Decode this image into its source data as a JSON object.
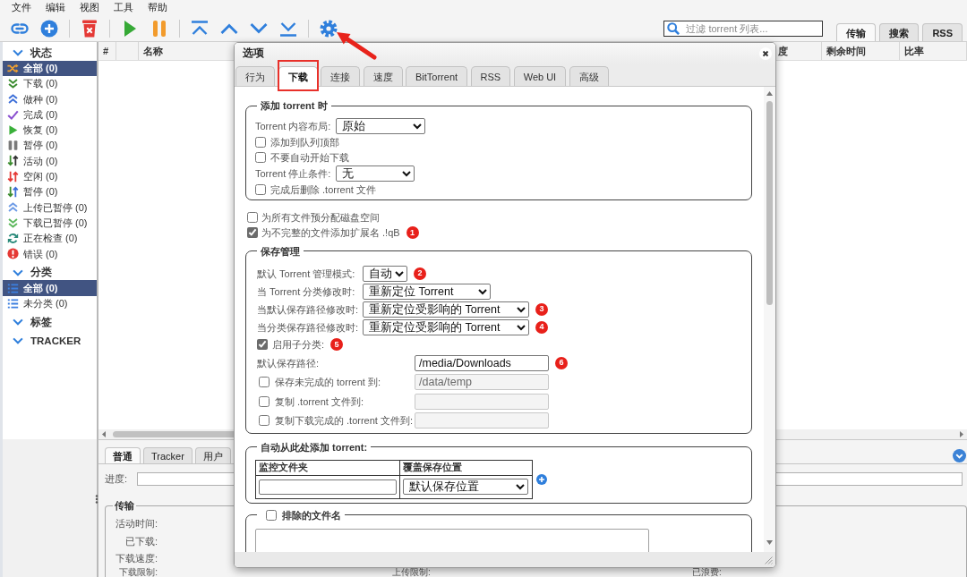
{
  "menu": [
    "文件",
    "编辑",
    "视图",
    "工具",
    "帮助"
  ],
  "search": {
    "placeholder": "过滤 torrent 列表..."
  },
  "view_tabs": [
    {
      "label": "传输",
      "selected": true
    },
    {
      "label": "搜索",
      "selected": false
    },
    {
      "label": "RSS",
      "selected": false
    }
  ],
  "sidebar": [
    {
      "title": "状态",
      "expanded": true,
      "items": [
        {
          "label": "全部 (0)",
          "selected": true
        },
        {
          "label": "下载 (0)",
          "selected": false
        },
        {
          "label": "做种 (0)",
          "selected": false
        },
        {
          "label": "完成 (0)",
          "selected": false
        },
        {
          "label": "恢复 (0)",
          "selected": false
        },
        {
          "label": "暂停 (0)",
          "selected": false
        },
        {
          "label": "活动 (0)",
          "selected": false
        },
        {
          "label": "空闲 (0)",
          "selected": false
        },
        {
          "label": "暂停 (0)",
          "selected": false
        },
        {
          "label": "上传已暂停 (0)",
          "selected": false
        },
        {
          "label": "下载已暂停 (0)",
          "selected": false
        },
        {
          "label": "正在检查 (0)",
          "selected": false
        },
        {
          "label": "错误 (0)",
          "selected": false
        }
      ]
    },
    {
      "title": "分类",
      "expanded": true,
      "items": [
        {
          "label": "全部 (0)",
          "selected": true
        },
        {
          "label": "未分类 (0)",
          "selected": false
        }
      ]
    },
    {
      "title": "标签",
      "expanded": true
    },
    {
      "title": "TRACKER",
      "expanded": true
    }
  ],
  "torrent_list": {
    "columns": [
      "#",
      "名称",
      "度",
      "剩余时间",
      "比率"
    ]
  },
  "details_panel": {
    "tabs": [
      {
        "label": "普通",
        "selected": true
      },
      {
        "label": "Tracker",
        "selected": false
      },
      {
        "label": "用户",
        "selected": false
      }
    ],
    "progress": {
      "label": "进度:",
      "level": 0
    },
    "transfer": {
      "title": "传输",
      "rows": [
        [
          "活动时间:"
        ],
        [
          "已下载:"
        ],
        [
          "下载速度:"
        ],
        [
          "下载限制:",
          "上传限制:",
          "已浪费:"
        ]
      ]
    }
  },
  "options_dialog": {
    "title": "选项",
    "tabs": [
      {
        "label": "行为",
        "selected": false,
        "highlighted": false
      },
      {
        "label": "下载",
        "selected": true,
        "highlighted": true
      },
      {
        "label": "连接",
        "selected": false,
        "highlighted": false
      },
      {
        "label": "速度",
        "selected": false,
        "highlighted": false
      },
      {
        "label": "BitTorrent",
        "selected": false,
        "highlighted": false
      },
      {
        "label": "RSS",
        "selected": false,
        "highlighted": false
      },
      {
        "label": "Web UI",
        "selected": false,
        "highlighted": false
      },
      {
        "label": "高级",
        "selected": false,
        "highlighted": false
      }
    ],
    "content": [
      {
        "kind": "group",
        "legend": "添加 torrent 时",
        "rows": [
          {
            "kind": "select",
            "label": "Torrent 内容布局:",
            "value": "原始"
          },
          {
            "kind": "checkbox",
            "label": "添加到队列顶部",
            "checked": false
          },
          {
            "kind": "checkbox",
            "label": "不要自动开始下载",
            "checked": false
          },
          {
            "kind": "select",
            "label": "Torrent 停止条件:",
            "value": "无"
          },
          {
            "kind": "checkbox",
            "label": "完成后删除 .torrent 文件",
            "checked": false
          }
        ]
      },
      {
        "kind": "checkbox",
        "label": "为所有文件预分配磁盘空间",
        "checked": false
      },
      {
        "kind": "checkbox",
        "label": "为不完整的文件添加扩展名 .!qB",
        "checked": true,
        "callout": "1"
      },
      {
        "kind": "group",
        "legend": "保存管理",
        "rows": [
          {
            "kind": "select",
            "label": "默认 Torrent 管理模式:",
            "value": "自动",
            "callout": "2"
          },
          {
            "kind": "select",
            "label": "当 Torrent 分类修改时:",
            "value": "重新定位 Torrent"
          },
          {
            "kind": "select",
            "label": "当默认保存路径修改时:",
            "value": "重新定位受影响的 Torrent",
            "callout": "3"
          },
          {
            "kind": "select",
            "label": "当分类保存路径修改时:",
            "value": "重新定位受影响的 Torrent",
            "callout": "4"
          },
          {
            "kind": "checkbox",
            "label": "启用子分类:",
            "checked": true,
            "callout": "5"
          },
          {
            "kind": "path",
            "label": "默认保存路径:",
            "value": "/media/Downloads",
            "callout": "6"
          },
          {
            "kind": "checked_path",
            "label": "保存未完成的 torrent 到:",
            "checked": false,
            "value": "/data/temp",
            "disabled": true
          },
          {
            "kind": "checked_path",
            "label": "复制 .torrent 文件到:",
            "checked": false,
            "disabled": true
          },
          {
            "kind": "checked_path",
            "label": "复制下载完成的 .torrent 文件到:",
            "checked": false,
            "disabled": true
          }
        ]
      },
      {
        "kind": "watch_folders",
        "legend": "自动从此处添加 torrent:",
        "columns": [
          "监控文件夹",
          "覆盖保存位置"
        ],
        "rows": [
          {
            "save_location": "默认保存位置"
          }
        ]
      },
      {
        "kind": "checkbox_group",
        "legend": "排除的文件名",
        "checked": false
      }
    ]
  }
}
